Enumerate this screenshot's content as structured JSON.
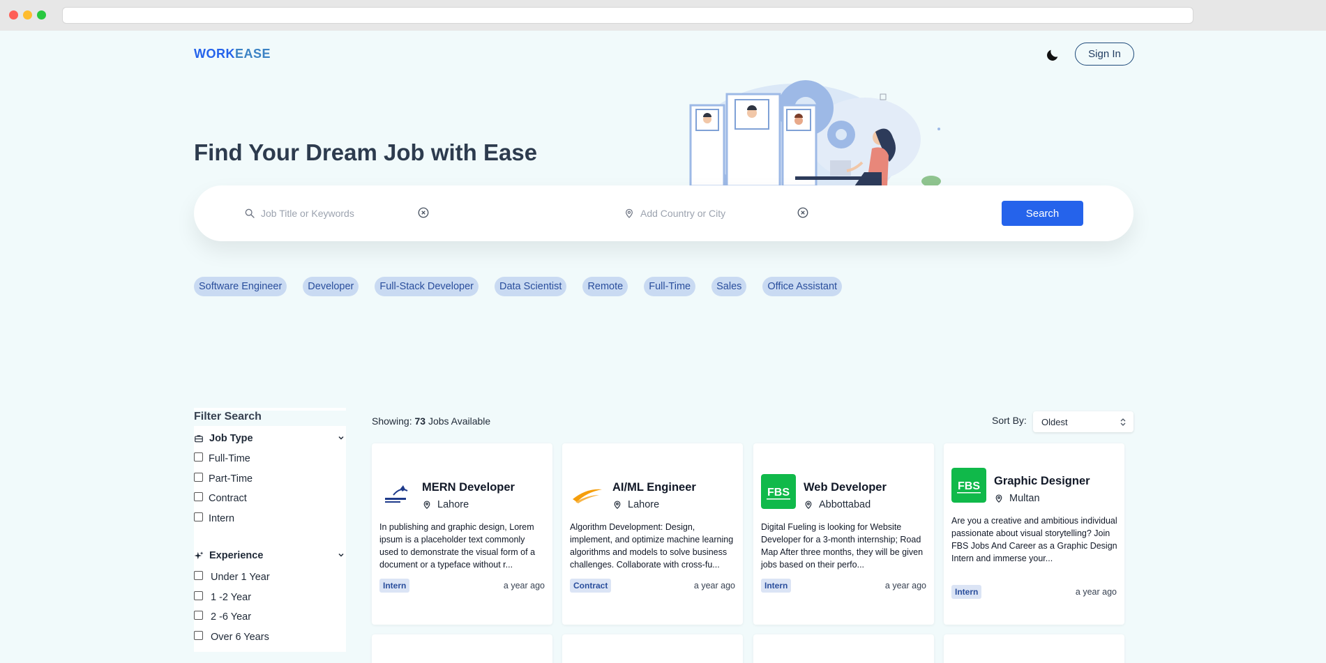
{
  "brand": {
    "part1": "WORK",
    "part2": "EASE"
  },
  "header": {
    "signin_label": "Sign In",
    "theme_icon": "moon-icon"
  },
  "hero": {
    "title": "Find Your Dream Job with Ease"
  },
  "search": {
    "job_placeholder": "Job Title or Keywords",
    "location_placeholder": "Add Country or City",
    "button_label": "Search"
  },
  "tags": [
    "Software Engineer",
    "Developer",
    "Full-Stack Developer",
    "Data Scientist",
    "Remote",
    "Full-Time",
    "Sales",
    "Office Assistant"
  ],
  "filter": {
    "title": "Filter Search",
    "job_type": {
      "label": "Job Type",
      "options": [
        "Full-Time",
        "Part-Time",
        "Contract",
        "Intern"
      ]
    },
    "experience": {
      "label": "Experience",
      "options": [
        "Under 1 Year",
        "1 -2 Year",
        "2 -6 Year",
        "Over 6 Years"
      ]
    }
  },
  "results": {
    "showing_prefix": "Showing:",
    "count": "73",
    "showing_suffix": "Jobs Available",
    "sort_label": "Sort By:",
    "sort_value": "Oldest"
  },
  "jobs": [
    {
      "title": "MERN Developer",
      "location": "Lahore",
      "description": "In publishing and graphic design, Lorem ipsum is a placeholder text commonly used to demonstrate the visual form of a document or a typeface without r...",
      "type": "Intern",
      "posted": "a year ago",
      "logo": "business-solutions-logo"
    },
    {
      "title": "AI/ML Engineer",
      "location": "Lahore",
      "description": "Algorithm Development: Design, implement, and optimize machine learning algorithms and models to solve business challenges. Collaborate with cross-fu...",
      "type": "Contract",
      "posted": "a year ago",
      "logo": "swoosh-logo"
    },
    {
      "title": "Web Developer",
      "location": "Abbottabad",
      "description": "Digital Fueling is looking for Website Developer for a 3-month internship; Road Map After three months, they will be given jobs based on their perfo...",
      "type": "Intern",
      "posted": "a year ago",
      "logo": "FBS"
    },
    {
      "title": "Graphic Designer",
      "location": "Multan",
      "description": "Are you a creative and ambitious individual passionate about visual storytelling? Join FBS Jobs And Career as a Graphic Design Intern and immerse your...",
      "type": "Intern",
      "posted": "a year ago",
      "logo": "FBS"
    }
  ],
  "colors": {
    "accent": "#2563eb",
    "background": "#f1fafb",
    "tag_bg": "#c9daf2",
    "fbs_green": "#10b94a"
  }
}
